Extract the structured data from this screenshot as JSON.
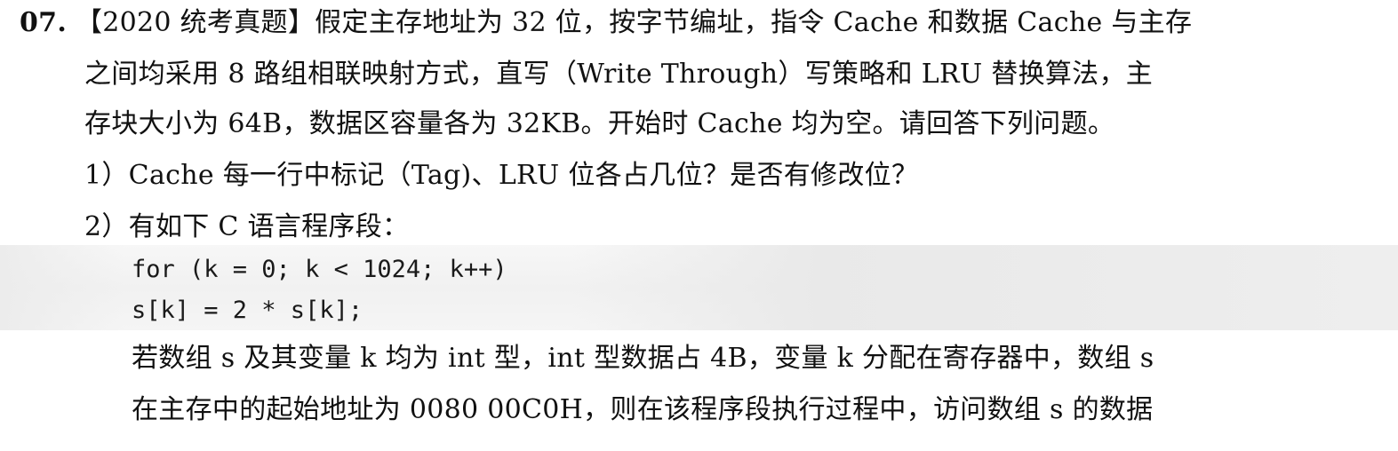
{
  "question": {
    "number": "07.",
    "lines": [
      "【2020 统考真题】假定主存地址为 32 位，按字节编址，指令 Cache 和数据 Cache 与主存",
      "之间均采用 8 路组相联映射方式，直写（Write  Through）写策略和 LRU 替换算法，主",
      "存块大小为 64B，数据区容量各为 32KB。开始时 Cache  均为空。请回答下列问题。"
    ]
  },
  "subquestions": {
    "q1": "1）Cache 每一行中标记（Tag)、LRU 位各占几位？是否有修改位？",
    "q2": "2）有如下 C 语言程序段："
  },
  "code": [
    "for (k = 0; k < 1024; k++)",
    "s[k] = 2 * s[k];"
  ],
  "after_code": [
    "若数组 s 及其变量 k 均为 int 型，int 型数据占 4B，变量 k 分配在寄存器中，数组 s",
    "在主存中的起始地址为 0080 00C0H，则在该程序段执行过程中，访问数组 s 的数据"
  ]
}
